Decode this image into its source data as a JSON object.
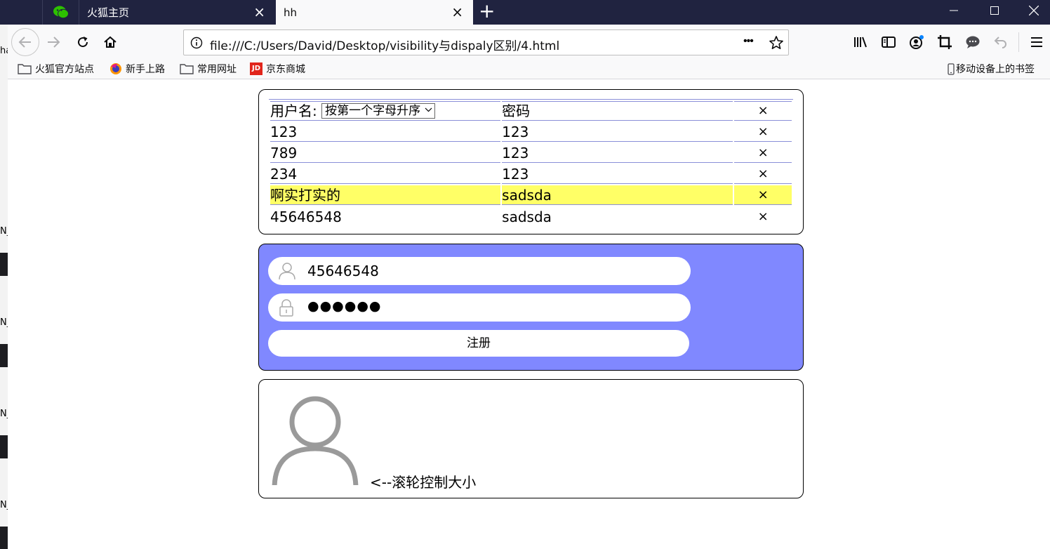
{
  "desktop": {
    "labels": [
      "ha",
      "N_",
      "N_",
      "N_",
      "N_"
    ]
  },
  "tabs": [
    {
      "label": "",
      "icon": "wechat-icon"
    },
    {
      "label": "火狐主页",
      "close": "×"
    },
    {
      "label": "hh",
      "close": "×",
      "active": true
    }
  ],
  "newtab_symbol": "+",
  "url": "file:///C:/Users/David/Desktop/visibility与dispaly区别/4.html",
  "url_more": "•••",
  "bookmarks": [
    {
      "label": "火狐官方站点",
      "icon": "folder-icon"
    },
    {
      "label": "新手上路",
      "icon": "firefox-icon"
    },
    {
      "label": "常用网址",
      "icon": "folder-icon"
    },
    {
      "label": "京东商城",
      "icon": "jd-icon"
    }
  ],
  "mobile_bookmarks": "移动设备上的书签",
  "jd_logo": "JD",
  "table": {
    "header": {
      "username_label": "用户名:",
      "sort_selected": "按第一个字母升序",
      "password_label": "密码",
      "delete": "×"
    },
    "rows": [
      {
        "username": "123",
        "password": "123",
        "delete": "×",
        "highlight": false
      },
      {
        "username": "789",
        "password": "123",
        "delete": "×",
        "highlight": false
      },
      {
        "username": "234",
        "password": "123",
        "delete": "×",
        "highlight": false
      },
      {
        "username": "啊实打实的",
        "password": "sadsda",
        "delete": "×",
        "highlight": true
      },
      {
        "username": "45646548",
        "password": "sadsda",
        "delete": "×",
        "highlight": false
      }
    ],
    "highlight_color": "#ffff66"
  },
  "form": {
    "username_value": "45646548",
    "password_value": "●●●●●●",
    "submit_label": "注册",
    "background_color": "#8088ff"
  },
  "avatar": {
    "caption": "<--滚轮控制大小"
  }
}
